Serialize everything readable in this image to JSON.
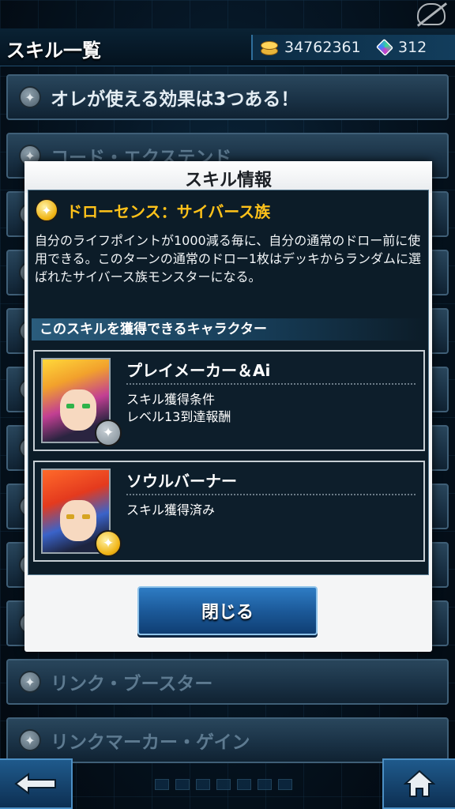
{
  "header": {
    "title": "スキル一覧",
    "gold": "34762361",
    "gems": "312"
  },
  "skill_list": [
    {
      "label": "オレが使える効果は3つある！",
      "top": true
    },
    {
      "label": "コード・エクステンド"
    },
    {
      "label": ""
    },
    {
      "label": ""
    },
    {
      "label": ""
    },
    {
      "label": ""
    },
    {
      "label": ""
    },
    {
      "label": ""
    },
    {
      "label": ""
    },
    {
      "label": ""
    },
    {
      "label": "リンク・ブースター"
    },
    {
      "label": "リンクマーカー・ゲイン"
    }
  ],
  "modal": {
    "title": "スキル情報",
    "skill_name": "ドローセンス：サイバース族",
    "skill_desc": "自分のライフポイントが1000減る毎に、自分の通常のドロー前に使用できる。このターンの通常のドロー1枚はデッキからランダムに選ばれたサイバース族モンスターになる。",
    "characters_header": "このスキルを獲得できるキャラクター",
    "characters": [
      {
        "name": "プレイメーカー＆Ai",
        "info1": "スキル獲得条件",
        "info2": "レベル13到達報酬",
        "badge": "grey"
      },
      {
        "name": "ソウルバーナー",
        "info1": "スキル獲得済み",
        "info2": "",
        "badge": "gold"
      }
    ],
    "close_label": "閉じる"
  },
  "icons": {
    "coin": "coin-stack-icon",
    "gem": "gem-icon",
    "star": "star-badge-icon",
    "back": "back-arrow-icon",
    "home": "home-icon"
  },
  "colors": {
    "skill_name": "#ffc21a",
    "button": "#1c5a9a",
    "panel": "#0c1c28"
  }
}
